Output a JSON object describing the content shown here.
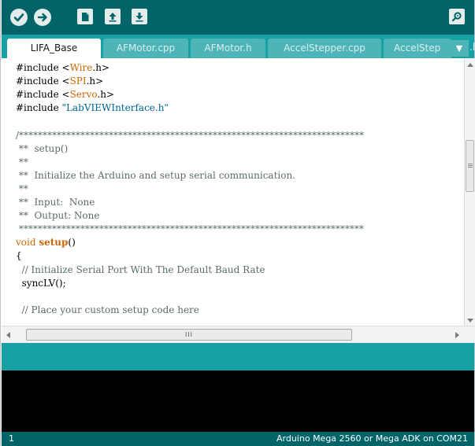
{
  "toolbar": {
    "buttons": [
      {
        "name": "verify-button",
        "icon": "checkmark-icon",
        "tooltip": ""
      },
      {
        "name": "upload-button",
        "icon": "right-arrow-icon",
        "tooltip": ""
      },
      {
        "name": "new-button",
        "icon": "new-file-icon",
        "tooltip": ""
      },
      {
        "name": "open-button",
        "icon": "open-arrow-up-icon",
        "tooltip": ""
      },
      {
        "name": "save-button",
        "icon": "save-arrow-down-icon",
        "tooltip": ""
      }
    ],
    "serial_monitor_icon": "magnifier-icon"
  },
  "tabs": [
    {
      "label": "LIFA_Base",
      "active": true
    },
    {
      "label": "AFMotor.cpp",
      "active": false
    },
    {
      "label": "AFMotor.h",
      "active": false
    },
    {
      "label": "AccelStepper.cpp",
      "active": false
    },
    {
      "label": "AccelStep",
      "active": false
    }
  ],
  "tab_overflow_text": ".h",
  "editor": {
    "lines": [
      {
        "parts": [
          {
            "t": "#include <",
            "c": ""
          },
          {
            "t": "Wire",
            "c": "lib"
          },
          {
            "t": ".h>",
            "c": ""
          }
        ]
      },
      {
        "parts": [
          {
            "t": "#include <",
            "c": ""
          },
          {
            "t": "SPI",
            "c": "lib"
          },
          {
            "t": ".h>",
            "c": ""
          }
        ]
      },
      {
        "parts": [
          {
            "t": "#include <",
            "c": ""
          },
          {
            "t": "Servo",
            "c": "lib"
          },
          {
            "t": ".h>",
            "c": ""
          }
        ]
      },
      {
        "parts": [
          {
            "t": "#include ",
            "c": ""
          },
          {
            "t": "\"LabVIEWInterface.h\"",
            "c": "str"
          }
        ]
      },
      {
        "parts": [
          {
            "t": "",
            "c": ""
          }
        ]
      },
      {
        "parts": [
          {
            "t": "/*************************************************************************",
            "c": "comment"
          }
        ]
      },
      {
        "parts": [
          {
            "t": " **  setup()",
            "c": "comment"
          }
        ]
      },
      {
        "parts": [
          {
            "t": " **",
            "c": "comment"
          }
        ]
      },
      {
        "parts": [
          {
            "t": " **  Initialize the Arduino and setup serial communication.",
            "c": "comment"
          }
        ]
      },
      {
        "parts": [
          {
            "t": " **",
            "c": "comment"
          }
        ]
      },
      {
        "parts": [
          {
            "t": " **  Input:  None",
            "c": "comment"
          }
        ]
      },
      {
        "parts": [
          {
            "t": " **  Output: None",
            "c": "comment"
          }
        ]
      },
      {
        "parts": [
          {
            "t": " *************************************************************************",
            "c": "comment"
          }
        ]
      },
      {
        "parts": [
          {
            "t": "void",
            "c": "type"
          },
          {
            "t": " ",
            "c": ""
          },
          {
            "t": "setup",
            "c": "func"
          },
          {
            "t": "()",
            "c": ""
          }
        ]
      },
      {
        "parts": [
          {
            "t": "{",
            "c": ""
          }
        ]
      },
      {
        "parts": [
          {
            "t": "  // Initialize Serial Port With The Default Baud Rate",
            "c": "comment"
          }
        ]
      },
      {
        "parts": [
          {
            "t": "  syncLV();",
            "c": ""
          }
        ]
      },
      {
        "parts": [
          {
            "t": "",
            "c": ""
          }
        ]
      },
      {
        "parts": [
          {
            "t": "  // Place your custom setup code here",
            "c": "comment"
          }
        ]
      }
    ]
  },
  "hscroll_grip": "III",
  "status": {
    "line_number": "1",
    "board": "Arduino Mega 2560 or Mega ADK on COM21"
  },
  "colors": {
    "toolbar": "#006468",
    "tabbar": "#17a1a5",
    "status": "#006468",
    "console": "#000000"
  }
}
